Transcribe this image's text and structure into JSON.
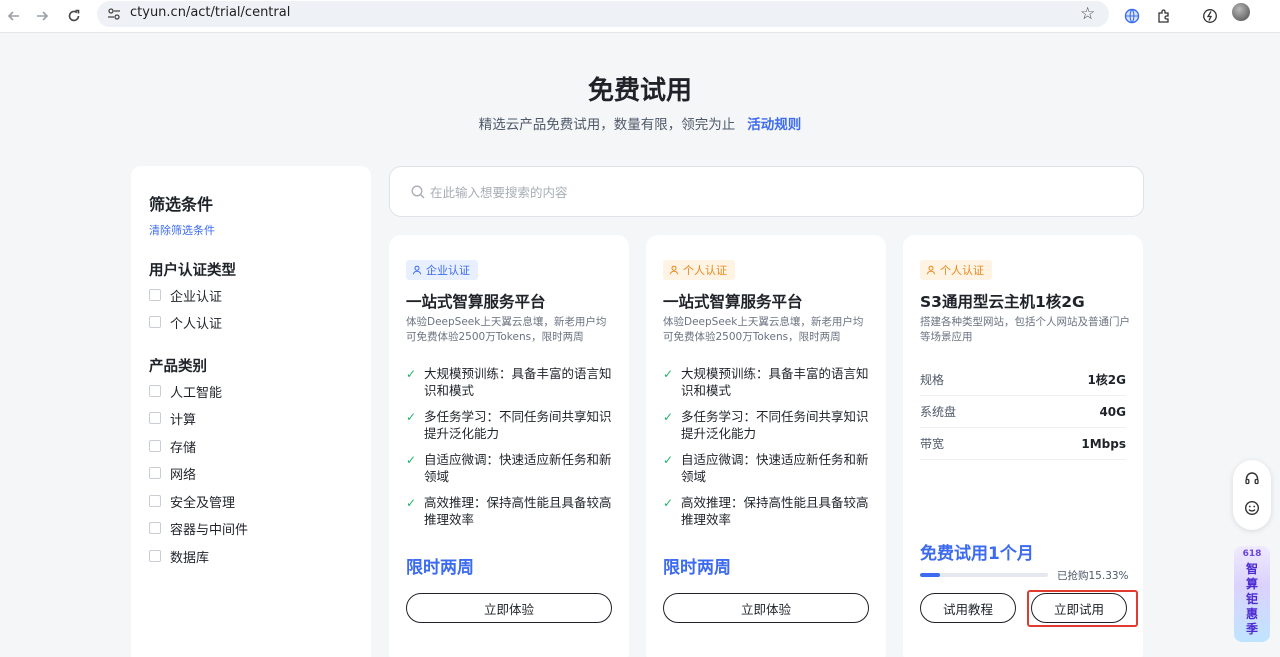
{
  "browser": {
    "url": "ctyun.cn/act/trial/central"
  },
  "header": {
    "title": "免费试用",
    "subtitle": "精选云产品免费试用，数量有限，领完为止",
    "rules_link": "活动规则"
  },
  "sidebar": {
    "title": "筛选条件",
    "clear_label": "清除筛选条件",
    "groups": [
      {
        "title": "用户认证类型",
        "options": [
          "企业认证",
          "个人认证"
        ]
      },
      {
        "title": "产品类别",
        "options": [
          "人工智能",
          "计算",
          "存储",
          "网络",
          "安全及管理",
          "容器与中间件",
          "数据库"
        ]
      }
    ]
  },
  "search": {
    "placeholder": "在此输入想要搜索的内容"
  },
  "cards": [
    {
      "badge": "企业认证",
      "title": "一站式智算服务平台",
      "desc": "体验DeepSeek上天翼云息壤，新老用户均可免费体验2500万Tokens，限时两周",
      "features": [
        "大规模预训练：具备丰富的语言知识和模式",
        "多任务学习：不同任务间共享知识提升泛化能力",
        "自适应微调：快速适应新任务和新领域",
        "高效推理：保持高性能且具备较高推理效率"
      ],
      "promo": "限时两周",
      "button": "立即体验"
    },
    {
      "badge": "个人认证",
      "title": "一站式智算服务平台",
      "desc": "体验DeepSeek上天翼云息壤，新老用户均可免费体验2500万Tokens，限时两周",
      "features": [
        "大规模预训练：具备丰富的语言知识和模式",
        "多任务学习：不同任务间共享知识提升泛化能力",
        "自适应微调：快速适应新任务和新领域",
        "高效推理：保持高性能且具备较高推理效率"
      ],
      "promo": "限时两周",
      "button": "立即体验"
    },
    {
      "badge": "个人认证",
      "title": "S3通用型云主机1核2G",
      "desc": "搭建各种类型网站，包括个人网站及普通门户等场景应用",
      "specs": [
        {
          "label": "规格",
          "value": "1核2G"
        },
        {
          "label": "系统盘",
          "value": "40G"
        },
        {
          "label": "带宽",
          "value": "1Mbps"
        }
      ],
      "promo": "免费试用1个月",
      "progress_percent": 15.33,
      "progress_text": "已抢购15.33%",
      "tutorial_button": "试用教程",
      "try_button": "立即试用"
    }
  ],
  "promo_widget": {
    "tag": "618",
    "chars": [
      "智",
      "算",
      "钜",
      "惠",
      "季"
    ]
  },
  "colors": {
    "accent": "#3d6bf0",
    "enterprise_badge_bg": "#e8effe",
    "personal_badge_bg": "#fff3e3",
    "personal_badge_text": "#e8891c",
    "check": "#23b26d",
    "highlight": "#e03b2e"
  }
}
